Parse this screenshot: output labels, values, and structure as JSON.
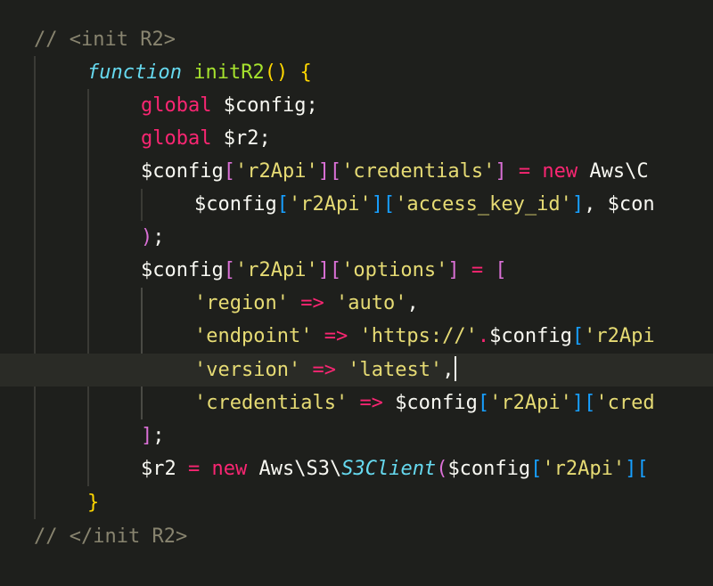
{
  "editor": {
    "theme_colors": {
      "background": "#1e1f1c",
      "comment": "#88846f",
      "keyword": "#f92672",
      "function_name": "#a6e22e",
      "storage": "#66d9ef",
      "string": "#e6db74",
      "default_text": "#f8f8f2",
      "bracket_level_1": "#ffd700",
      "bracket_level_2": "#da70d6",
      "bracket_level_3": "#179fff"
    },
    "lines": [
      {
        "tokens": [
          {
            "c": "t-comment",
            "t": "// <init R2>"
          }
        ]
      },
      {
        "tokens": [
          {
            "c": "t-storage",
            "t": "function"
          },
          {
            "c": "t-punct",
            "t": " "
          },
          {
            "c": "t-fn",
            "t": "initR2"
          },
          {
            "c": "b-yellow",
            "t": "()"
          },
          {
            "c": "t-punct",
            "t": " "
          },
          {
            "c": "b-yellow",
            "t": "{"
          }
        ]
      },
      {
        "tokens": [
          {
            "c": "t-keyword",
            "t": "global"
          },
          {
            "c": "t-punct",
            "t": " "
          },
          {
            "c": "t-var",
            "t": "$config"
          },
          {
            "c": "t-punct",
            "t": ";"
          }
        ]
      },
      {
        "tokens": [
          {
            "c": "t-keyword",
            "t": "global"
          },
          {
            "c": "t-punct",
            "t": " "
          },
          {
            "c": "t-var",
            "t": "$r2"
          },
          {
            "c": "t-punct",
            "t": ";"
          }
        ]
      },
      {
        "tokens": [
          {
            "c": "t-var",
            "t": "$config"
          },
          {
            "c": "b-pink",
            "t": "["
          },
          {
            "c": "t-str",
            "t": "'r2Api'"
          },
          {
            "c": "b-pink",
            "t": "]["
          },
          {
            "c": "t-str",
            "t": "'credentials'"
          },
          {
            "c": "b-pink",
            "t": "]"
          },
          {
            "c": "t-punct",
            "t": " "
          },
          {
            "c": "t-op",
            "t": "="
          },
          {
            "c": "t-punct",
            "t": " "
          },
          {
            "c": "t-keyword",
            "t": "new"
          },
          {
            "c": "t-punct",
            "t": " "
          },
          {
            "c": "t-var",
            "t": "Aws\\C"
          }
        ]
      },
      {
        "tokens": [
          {
            "c": "t-var",
            "t": "$config"
          },
          {
            "c": "b-blue",
            "t": "["
          },
          {
            "c": "t-str",
            "t": "'r2Api'"
          },
          {
            "c": "b-blue",
            "t": "]["
          },
          {
            "c": "t-str",
            "t": "'access_key_id'"
          },
          {
            "c": "b-blue",
            "t": "]"
          },
          {
            "c": "t-punct",
            "t": ", "
          },
          {
            "c": "t-var",
            "t": "$con"
          }
        ]
      },
      {
        "tokens": [
          {
            "c": "b-pink",
            "t": ")"
          },
          {
            "c": "t-punct",
            "t": ";"
          }
        ]
      },
      {
        "tokens": [
          {
            "c": "t-var",
            "t": "$config"
          },
          {
            "c": "b-pink",
            "t": "["
          },
          {
            "c": "t-str",
            "t": "'r2Api'"
          },
          {
            "c": "b-pink",
            "t": "]["
          },
          {
            "c": "t-str",
            "t": "'options'"
          },
          {
            "c": "b-pink",
            "t": "]"
          },
          {
            "c": "t-punct",
            "t": " "
          },
          {
            "c": "t-op",
            "t": "="
          },
          {
            "c": "t-punct",
            "t": " "
          },
          {
            "c": "b-pink",
            "t": "["
          }
        ]
      },
      {
        "tokens": [
          {
            "c": "t-str",
            "t": "'region'"
          },
          {
            "c": "t-punct",
            "t": " "
          },
          {
            "c": "t-op",
            "t": "=>"
          },
          {
            "c": "t-punct",
            "t": " "
          },
          {
            "c": "t-str",
            "t": "'auto'"
          },
          {
            "c": "t-punct",
            "t": ","
          }
        ]
      },
      {
        "tokens": [
          {
            "c": "t-str",
            "t": "'endpoint'"
          },
          {
            "c": "t-punct",
            "t": " "
          },
          {
            "c": "t-op",
            "t": "=>"
          },
          {
            "c": "t-punct",
            "t": " "
          },
          {
            "c": "t-str",
            "t": "'https://'"
          },
          {
            "c": "t-op",
            "t": "."
          },
          {
            "c": "t-var",
            "t": "$config"
          },
          {
            "c": "b-blue",
            "t": "["
          },
          {
            "c": "t-str",
            "t": "'r2Api"
          }
        ]
      },
      {
        "tokens": [
          {
            "c": "t-str",
            "t": "'version'"
          },
          {
            "c": "t-punct",
            "t": " "
          },
          {
            "c": "t-op",
            "t": "=>"
          },
          {
            "c": "t-punct",
            "t": " "
          },
          {
            "c": "t-str",
            "t": "'latest'"
          },
          {
            "c": "t-punct",
            "t": ","
          }
        ]
      },
      {
        "tokens": [
          {
            "c": "t-str",
            "t": "'credentials'"
          },
          {
            "c": "t-punct",
            "t": " "
          },
          {
            "c": "t-op",
            "t": "=>"
          },
          {
            "c": "t-punct",
            "t": " "
          },
          {
            "c": "t-var",
            "t": "$config"
          },
          {
            "c": "b-blue",
            "t": "["
          },
          {
            "c": "t-str",
            "t": "'r2Api'"
          },
          {
            "c": "b-blue",
            "t": "]["
          },
          {
            "c": "t-str",
            "t": "'cred"
          }
        ]
      },
      {
        "tokens": [
          {
            "c": "b-pink",
            "t": "]"
          },
          {
            "c": "t-punct",
            "t": ";"
          }
        ]
      },
      {
        "tokens": [
          {
            "c": "t-var",
            "t": "$r2"
          },
          {
            "c": "t-punct",
            "t": " "
          },
          {
            "c": "t-op",
            "t": "="
          },
          {
            "c": "t-punct",
            "t": " "
          },
          {
            "c": "t-keyword",
            "t": "new"
          },
          {
            "c": "t-punct",
            "t": " "
          },
          {
            "c": "t-var",
            "t": "Aws\\S3\\"
          },
          {
            "c": "t-class",
            "t": "S3Client"
          },
          {
            "c": "b-pink",
            "t": "("
          },
          {
            "c": "t-var",
            "t": "$config"
          },
          {
            "c": "b-blue",
            "t": "["
          },
          {
            "c": "t-str",
            "t": "'r2Api'"
          },
          {
            "c": "b-blue",
            "t": "]["
          }
        ]
      },
      {
        "tokens": [
          {
            "c": "b-yellow",
            "t": "}"
          }
        ]
      },
      {
        "tokens": [
          {
            "c": "t-comment",
            "t": "// </init R2>"
          }
        ]
      }
    ]
  }
}
